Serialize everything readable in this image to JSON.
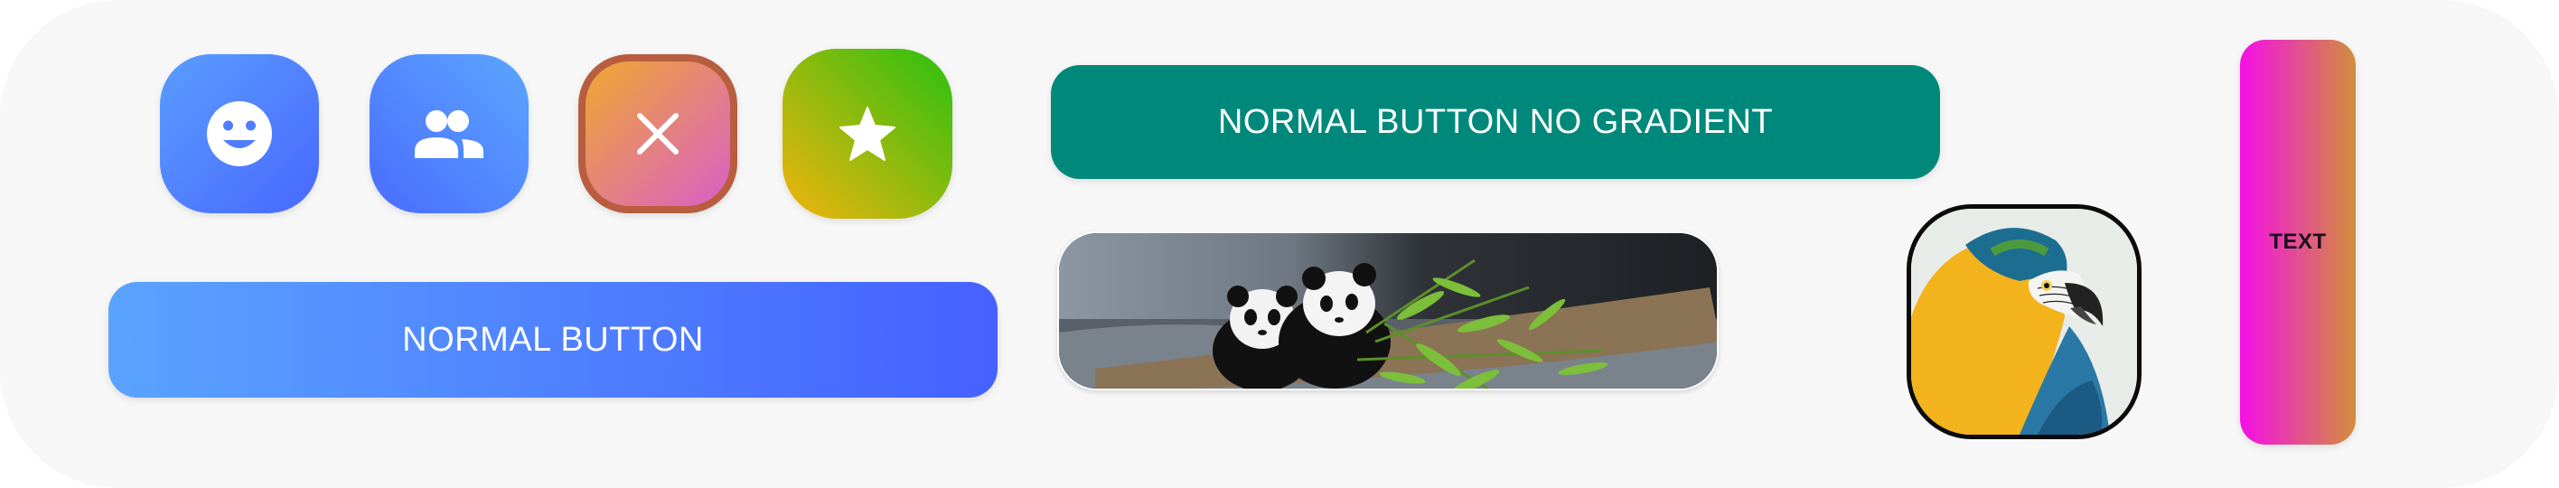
{
  "icon_buttons": {
    "emoji": {
      "icon": "smiley-face-icon"
    },
    "people": {
      "icon": "people-group-icon"
    },
    "close": {
      "icon": "close-icon"
    },
    "star": {
      "icon": "star-icon"
    }
  },
  "buttons": {
    "normal_label": "NORMAL BUTTON",
    "no_gradient_label": "NORMAL BUTTON NO GRADIENT",
    "text_label": "TEXT"
  },
  "images": {
    "panda": {
      "subject": "two pandas eating bamboo"
    },
    "parrot": {
      "subject": "blue-and-yellow macaw"
    }
  },
  "colors": {
    "panel_background": "#f7f7f7",
    "blue_gradient_start": "#5aa3ff",
    "blue_gradient_end": "#4561ff",
    "teal": "#00897b",
    "close_gradient_start": "#f0a830",
    "close_gradient_end": "#d85fc8",
    "close_border": "#b85d40",
    "star_gradient_start": "#f4b30c",
    "star_gradient_end": "#29c10f",
    "text_gradient_start": "#f50fe8",
    "text_gradient_end": "#d28e3a"
  }
}
